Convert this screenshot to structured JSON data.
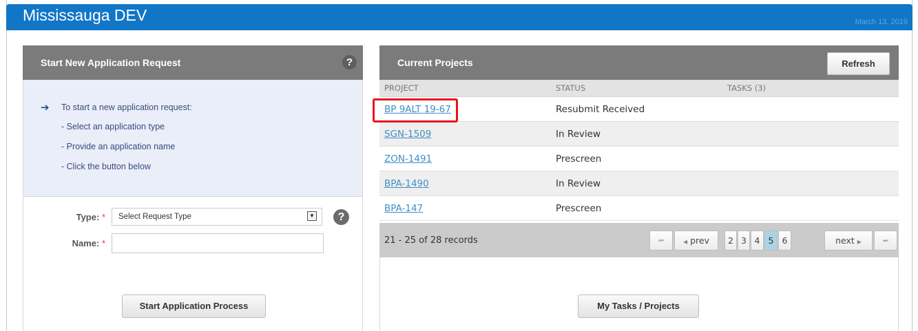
{
  "app": {
    "title": "Mississauga DEV",
    "date": "March 13, 2019"
  },
  "left_panel": {
    "title": "Start New Application Request",
    "help": "?",
    "info_lines": [
      "To start a new application request:",
      "- Select an application type",
      "- Provide an application name",
      "- Click the button below"
    ],
    "type_label": "Type:",
    "name_label": "Name:",
    "required_mark": "*",
    "type_select_value": "Select Request Type",
    "name_value": "",
    "start_button": "Start Application Process"
  },
  "right_panel": {
    "title": "Current Projects",
    "refresh_button": "Refresh",
    "columns": [
      "PROJECT",
      "STATUS",
      "TASKS (3)"
    ],
    "rows": [
      {
        "project": "BP 9ALT 19-67",
        "status": "Resubmit Received"
      },
      {
        "project": "SGN-1509",
        "status": "In Review"
      },
      {
        "project": "ZON-1491",
        "status": "Prescreen"
      },
      {
        "project": "BPA-1490",
        "status": "In Review"
      },
      {
        "project": "BPA-147",
        "status": "Prescreen"
      }
    ],
    "records": "21 - 25 of 28 records",
    "pager": {
      "first": "⏮",
      "prev": "prev",
      "pages": [
        "2",
        "3",
        "4",
        "5",
        "6"
      ],
      "active_page": "5",
      "next": "next",
      "last": "⏭"
    },
    "tasks_button": "My Tasks / Projects"
  },
  "colors": {
    "topbar": "#1276c7",
    "panel_header": "#7b7b7b",
    "link": "#3f8fc4",
    "highlight": "#e8141b",
    "active_page": "#a9d4e8"
  }
}
